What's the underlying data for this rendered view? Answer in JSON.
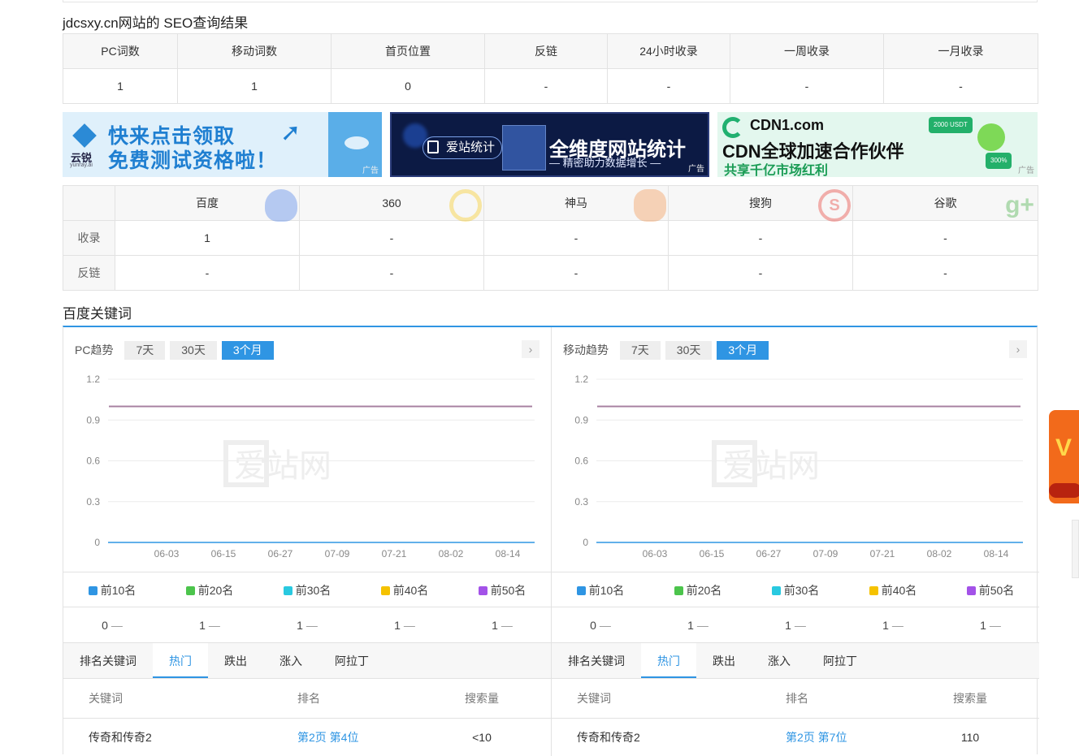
{
  "site_title": "jdcsxy.cn网站的 SEO查询结果",
  "summary": {
    "headers": [
      "PC词数",
      "移动词数",
      "首页位置",
      "反链",
      "24小时收录",
      "一周收录",
      "一月收录"
    ],
    "values": [
      "1",
      "1",
      "0",
      "-",
      "-",
      "-",
      "-"
    ]
  },
  "ads": [
    {
      "brand": "云锐",
      "brand_sub": "yunray.ai",
      "line1": "快来点击领取",
      "line2": "免费测试资格啦！",
      "tag": "广告"
    },
    {
      "brand": "爱站统计",
      "line1": "全维度网站统计",
      "line2": "— 精密助力数据增长 —",
      "tag": "广告"
    },
    {
      "brand": "CDN1.com",
      "line1": "CDN全球加速合作伙伴",
      "line2": "共享千亿市场红利",
      "badge1": "2000 USDT",
      "badge2": "300%",
      "tag": "广告"
    }
  ],
  "engines": {
    "names": [
      "百度",
      "360",
      "神马",
      "搜狗",
      "谷歌"
    ],
    "rows": [
      {
        "label": "收录",
        "values": [
          "1",
          "-",
          "-",
          "-",
          "-"
        ]
      },
      {
        "label": "反链",
        "values": [
          "-",
          "-",
          "-",
          "-",
          "-"
        ]
      }
    ]
  },
  "keywords_title": "百度关键词",
  "panels": [
    {
      "label": "PC趋势",
      "ranges": [
        "7天",
        "30天",
        "3个月"
      ],
      "active_range": "3个月",
      "next": "›",
      "watermark": "爱站网",
      "chart_data": {
        "type": "line",
        "x": [
          "06-03",
          "06-15",
          "06-27",
          "07-09",
          "07-21",
          "08-02",
          "08-14"
        ],
        "yticks": [
          "1.2",
          "0.9",
          "0.6",
          "0.3",
          "0"
        ],
        "ylim": [
          0,
          1.2
        ],
        "series": [
          {
            "name": "前10名",
            "value": 0,
            "color": "#2f95e3"
          },
          {
            "name": "前20名",
            "value": 1,
            "color": "#4cc44c"
          },
          {
            "name": "前30名",
            "value": 1,
            "color": "#29c9e0"
          },
          {
            "name": "前40名",
            "value": 1,
            "color": "#f5c200"
          },
          {
            "name": "前50名",
            "value": 1,
            "color": "#a352e8"
          }
        ]
      },
      "legend": [
        "前10名",
        "前20名",
        "前30名",
        "前40名",
        "前50名"
      ],
      "counts": [
        "0",
        "1",
        "1",
        "1",
        "1"
      ],
      "trend": "—",
      "tabs": [
        "排名关键词",
        "热门",
        "跌出",
        "涨入",
        "阿拉丁"
      ],
      "active_tab": "热门",
      "table_headers": [
        "关键词",
        "排名",
        "搜索量"
      ],
      "rows": [
        {
          "keyword": "传奇和传奇2",
          "rank": "第2页 第4位",
          "volume": "<10"
        }
      ]
    },
    {
      "label": "移动趋势",
      "ranges": [
        "7天",
        "30天",
        "3个月"
      ],
      "active_range": "3个月",
      "next": "›",
      "watermark": "爱站网",
      "chart_data": {
        "type": "line",
        "x": [
          "06-03",
          "06-15",
          "06-27",
          "07-09",
          "07-21",
          "08-02",
          "08-14"
        ],
        "yticks": [
          "1.2",
          "0.9",
          "0.6",
          "0.3",
          "0"
        ],
        "ylim": [
          0,
          1.2
        ],
        "series": [
          {
            "name": "前10名",
            "value": 0,
            "color": "#2f95e3"
          },
          {
            "name": "前20名",
            "value": 1,
            "color": "#4cc44c"
          },
          {
            "name": "前30名",
            "value": 1,
            "color": "#29c9e0"
          },
          {
            "name": "前40名",
            "value": 1,
            "color": "#f5c200"
          },
          {
            "name": "前50名",
            "value": 1,
            "color": "#a352e8"
          }
        ]
      },
      "legend": [
        "前10名",
        "前20名",
        "前30名",
        "前40名",
        "前50名"
      ],
      "counts": [
        "0",
        "1",
        "1",
        "1",
        "1"
      ],
      "trend": "—",
      "tabs": [
        "排名关键词",
        "热门",
        "跌出",
        "涨入",
        "阿拉丁"
      ],
      "active_tab": "热门",
      "table_headers": [
        "关键词",
        "排名",
        "搜索量"
      ],
      "rows": [
        {
          "keyword": "传奇和传奇2",
          "rank": "第2页 第7位",
          "volume": "110"
        }
      ]
    }
  ],
  "colors": {
    "accent": "#2f95e3",
    "line": "#a67fa0"
  }
}
